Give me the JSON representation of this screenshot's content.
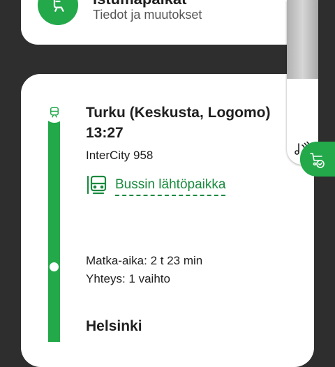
{
  "seat_section": {
    "title": "Istumapaikat",
    "subtitle": "Tiedot ja muutokset",
    "icon": "seat-icon"
  },
  "journey": {
    "origin_station": "Turku (Keskusta, Logomo)",
    "departure_time": "13:27",
    "train": "InterCity 958",
    "bus_departure_link": "Bussin lähtöpaikka",
    "duration": "Matka-aika: 2 t 23 min",
    "connection": "Yhteys: 1 vaihto",
    "destination_station": "Helsinki"
  },
  "side_panel": {
    "audio_icon": "audio-icon",
    "cart_icon": "cart-check-icon"
  },
  "colors": {
    "accent": "#23a84a",
    "link": "#1a8a3e",
    "background": "#2e2e2e"
  }
}
